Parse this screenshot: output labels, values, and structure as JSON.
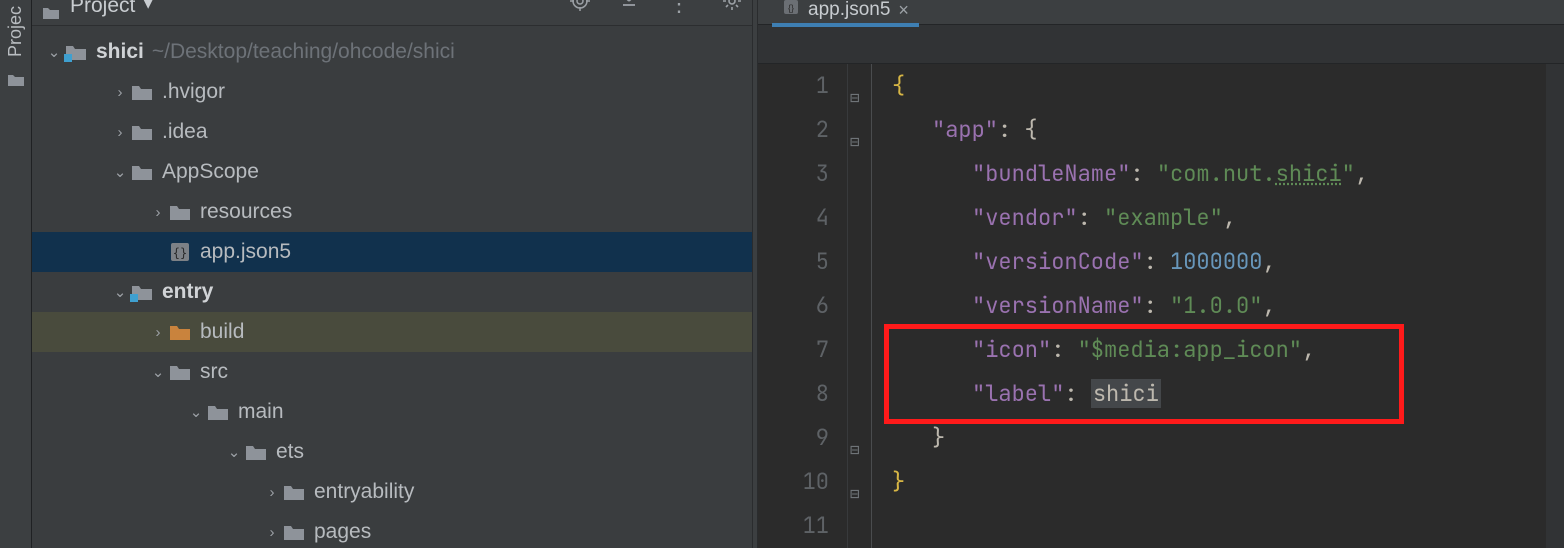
{
  "sidebar": {
    "tab_label": "Projec"
  },
  "toolbar": {
    "title": "Project",
    "arrow": "▾"
  },
  "icons": {
    "folder": "folder-icon",
    "module": "module-icon",
    "json": "json-file-icon",
    "target": "target-icon",
    "download": "download-icon",
    "more": "more-icon",
    "gear": "gear-icon",
    "close": "close-icon"
  },
  "tree": {
    "root": {
      "name": "shici",
      "path": "~/Desktop/teaching/ohcode/shici",
      "expanded": true,
      "kind": "module"
    },
    "items": [
      {
        "depth": 1,
        "arrow": ">",
        "kind": "folder",
        "name": ".hvigor"
      },
      {
        "depth": 1,
        "arrow": ">",
        "kind": "folder",
        "name": ".idea"
      },
      {
        "depth": 1,
        "arrow": "v",
        "kind": "folder",
        "name": "AppScope"
      },
      {
        "depth": 2,
        "arrow": ">",
        "kind": "folder",
        "name": "resources"
      },
      {
        "depth": 2,
        "arrow": "",
        "kind": "jsonfile",
        "name": "app.json5",
        "selected": true
      },
      {
        "depth": 1,
        "arrow": "v",
        "kind": "module",
        "name": "entry",
        "bold": true
      },
      {
        "depth": 2,
        "arrow": ">",
        "kind": "folder-o",
        "name": "build",
        "build": true
      },
      {
        "depth": 2,
        "arrow": "v",
        "kind": "folder",
        "name": "src"
      },
      {
        "depth": 3,
        "arrow": "v",
        "kind": "folder",
        "name": "main"
      },
      {
        "depth": 4,
        "arrow": "v",
        "kind": "folder",
        "name": "ets"
      },
      {
        "depth": 5,
        "arrow": ">",
        "kind": "folder",
        "name": "entryability"
      },
      {
        "depth": 5,
        "arrow": ">",
        "kind": "folder",
        "name": "pages"
      }
    ]
  },
  "tabs": {
    "active": {
      "label": "app.json5"
    }
  },
  "code": {
    "lines": [
      {
        "n": 1,
        "ind": 0,
        "frags": [
          {
            "t": "{",
            "c": "brace"
          }
        ]
      },
      {
        "n": 2,
        "ind": 1,
        "frags": [
          {
            "t": "\"app\"",
            "c": "key"
          },
          {
            "t": ": {",
            "c": "plain"
          }
        ]
      },
      {
        "n": 3,
        "ind": 2,
        "frags": [
          {
            "t": "\"bundleName\"",
            "c": "key"
          },
          {
            "t": ": ",
            "c": "plain"
          },
          {
            "t": "\"com.nut.",
            "c": "str"
          },
          {
            "t": "shici",
            "c": "str under"
          },
          {
            "t": "\"",
            "c": "str"
          },
          {
            "t": ",",
            "c": "plain"
          }
        ]
      },
      {
        "n": 4,
        "ind": 2,
        "frags": [
          {
            "t": "\"vendor\"",
            "c": "key"
          },
          {
            "t": ": ",
            "c": "plain"
          },
          {
            "t": "\"example\"",
            "c": "str"
          },
          {
            "t": ",",
            "c": "plain"
          }
        ]
      },
      {
        "n": 5,
        "ind": 2,
        "frags": [
          {
            "t": "\"versionCode\"",
            "c": "key"
          },
          {
            "t": ": ",
            "c": "plain"
          },
          {
            "t": "1000000",
            "c": "num"
          },
          {
            "t": ",",
            "c": "plain"
          }
        ]
      },
      {
        "n": 6,
        "ind": 2,
        "frags": [
          {
            "t": "\"versionName\"",
            "c": "key"
          },
          {
            "t": ": ",
            "c": "plain"
          },
          {
            "t": "\"1.0.0\"",
            "c": "str"
          },
          {
            "t": ",",
            "c": "plain"
          }
        ]
      },
      {
        "n": 7,
        "ind": 2,
        "frags": [
          {
            "t": "\"icon\"",
            "c": "key"
          },
          {
            "t": ": ",
            "c": "plain"
          },
          {
            "t": "\"$media:app_icon\"",
            "c": "str"
          },
          {
            "t": ",",
            "c": "plain"
          }
        ]
      },
      {
        "n": 8,
        "ind": 2,
        "frags": [
          {
            "t": "\"label\"",
            "c": "key"
          },
          {
            "t": ": ",
            "c": "plain"
          },
          {
            "t": "shici",
            "c": "err"
          }
        ]
      },
      {
        "n": 9,
        "ind": 1,
        "frags": [
          {
            "t": "}",
            "c": "plain"
          }
        ]
      },
      {
        "n": 10,
        "ind": 0,
        "frags": [
          {
            "t": "}",
            "c": "brace"
          }
        ]
      },
      {
        "n": 11,
        "ind": 0,
        "frags": []
      }
    ],
    "fold_marks": [
      {
        "line": 1,
        "glyph": "⊟"
      },
      {
        "line": 2,
        "glyph": "⊟"
      },
      {
        "line": 9,
        "glyph": "⊟"
      },
      {
        "line": 10,
        "glyph": "⊟"
      }
    ],
    "highlight": {
      "from_line": 7,
      "to_line": 8
    }
  }
}
